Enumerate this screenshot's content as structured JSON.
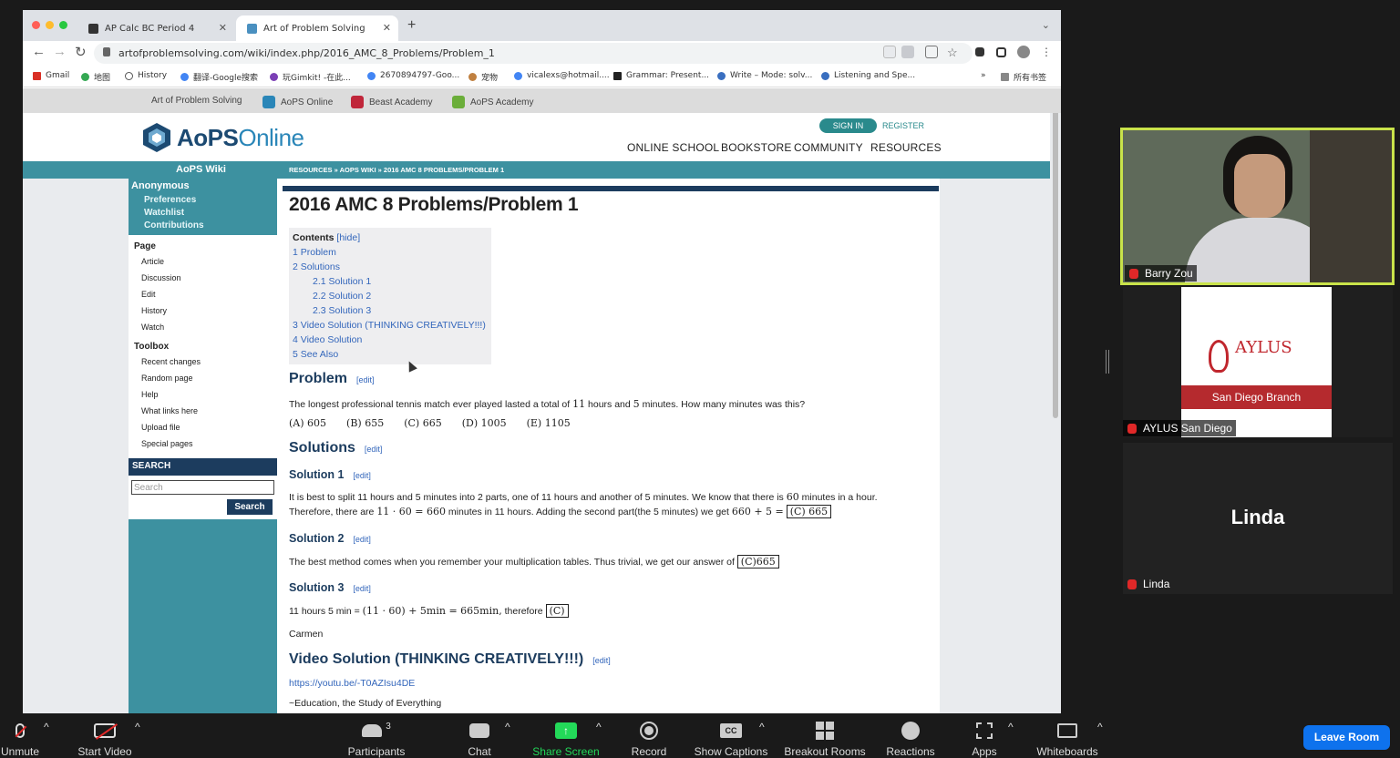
{
  "browser": {
    "tabs": [
      {
        "title": "AP Calc BC Period 4"
      },
      {
        "title": "Art of Problem Solving"
      }
    ],
    "url": "artofproblemsolving.com/wiki/index.php/2016_AMC_8_Problems/Problem_1",
    "bookmarks": [
      "Gmail",
      "地图",
      "History",
      "翻译-Google搜索",
      "玩Gimkit! -在此...",
      "2670894797-Goo...",
      "宠物",
      "vicalexs@hotmail....",
      "Grammar: Present...",
      "Write – Mode: solv...",
      "Listening and Spe...",
      "»",
      "所有书签"
    ]
  },
  "site": {
    "network": [
      "Art of Problem Solving",
      "AoPS Online",
      "Beast Academy",
      "AoPS Academy"
    ],
    "logo_main": "AoPS",
    "logo_sub": "Online",
    "sign_in": "SIGN IN",
    "register": "REGISTER",
    "nav": [
      "ONLINE SCHOOL",
      "BOOKSTORE",
      "COMMUNITY",
      "RESOURCES"
    ],
    "wiki_title": "AoPS Wiki",
    "breadcrumb": "RESOURCES » AOPS WIKI » 2016 AMC 8 PROBLEMS/PROBLEM 1"
  },
  "sidebar": {
    "user": "Anonymous",
    "user_links": [
      "Preferences",
      "Watchlist",
      "Contributions"
    ],
    "page_heading": "Page",
    "page_links": [
      "Article",
      "Discussion",
      "Edit",
      "History",
      "Watch"
    ],
    "toolbox_heading": "Toolbox",
    "toolbox_links": [
      "Recent changes",
      "Random page",
      "Help",
      "What links here",
      "Upload file",
      "Special pages"
    ],
    "search_heading": "SEARCH",
    "search_placeholder": "Search",
    "search_button": "Search"
  },
  "article": {
    "title": "2016 AMC 8 Problems/Problem 1",
    "toc_title": "Contents",
    "toc_hide": "[hide]",
    "toc": [
      {
        "text": "1 Problem",
        "level": 1
      },
      {
        "text": "2 Solutions",
        "level": 1
      },
      {
        "text": "2.1 Solution 1",
        "level": 2
      },
      {
        "text": "2.2 Solution 2",
        "level": 2
      },
      {
        "text": "2.3 Solution 3",
        "level": 2
      },
      {
        "text": "3 Video Solution (THINKING CREATIVELY!!!)",
        "level": 1
      },
      {
        "text": "4 Video Solution",
        "level": 1
      },
      {
        "text": "5 See Also",
        "level": 1
      }
    ],
    "edit": "[edit]",
    "problem_heading": "Problem",
    "problem_text_a": "The longest professional tennis match ever played lasted a total of ",
    "problem_m1": "11",
    "problem_text_b": " hours and ",
    "problem_m2": "5",
    "problem_text_c": " minutes. How many minutes was this?",
    "choices": [
      "(A) 605",
      "(B) 655",
      "(C) 665",
      "(D) 1005",
      "(E) 1105"
    ],
    "solutions_heading": "Solutions",
    "s1_heading": "Solution 1",
    "s1_line1a": "It is best to split 11 hours and 5 minutes into 2 parts, one of 11 hours and another of 5 minutes. We know that there is ",
    "s1_line1m": "60",
    "s1_line1b": " minutes in a hour.",
    "s1_line2a": "Therefore, there are ",
    "s1_line2m": "11 · 60 = 660",
    "s1_line2b": " minutes in 11 hours. Adding the second part(the 5 minutes) we get ",
    "s1_line2m2": "660 + 5 =",
    "s1_line2box": "(C) 665",
    "s2_heading": "Solution 2",
    "s2_text": "The best method comes when you remember your multiplication tables. Thus trivial, we get our answer of ",
    "s2_box": "(C)665",
    "s3_heading": "Solution 3",
    "s3_text_a": "11 hours 5 min = ",
    "s3_math": "(11 · 60) + 5min = 665min,",
    "s3_text_b": " therefore ",
    "s3_box": "(C)",
    "s3_author": "Carmen",
    "video_heading": "Video Solution (THINKING CREATIVELY!!!)",
    "video_link": "https://youtu.be/-T0AZIsu4DE",
    "video_credit": "~Education, the Study of Everything"
  },
  "participants": [
    {
      "name": "Barry Zou"
    },
    {
      "name": "AYLUS San Diego",
      "card_title": "AYLUS",
      "card_sub": "San Diego Branch"
    },
    {
      "name": "Linda",
      "big_name": "Linda"
    }
  ],
  "zoom": {
    "buttons": [
      "Unmute",
      "Start Video",
      "Participants",
      "Chat",
      "Share Screen",
      "Record",
      "Show Captions",
      "Breakout Rooms",
      "Reactions",
      "Apps",
      "Whiteboards"
    ],
    "participant_count": "3",
    "leave": "Leave Room"
  }
}
